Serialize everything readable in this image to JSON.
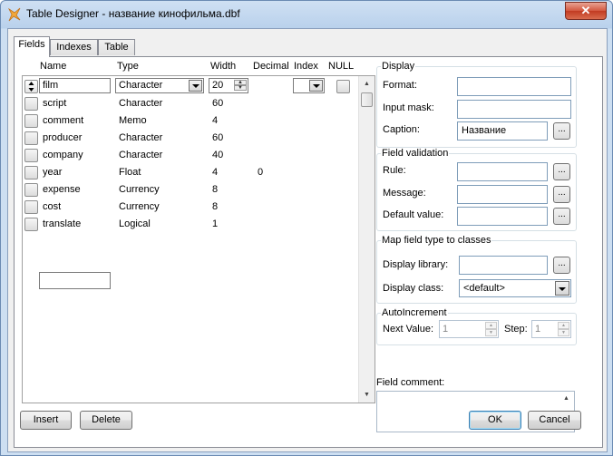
{
  "window": {
    "title": "Table Designer - название кинофильма.dbf",
    "close_glyph": "✕"
  },
  "tabs": [
    {
      "label": "Fields"
    },
    {
      "label": "Indexes"
    },
    {
      "label": "Table"
    }
  ],
  "grid": {
    "headers": {
      "name": "Name",
      "type": "Type",
      "width": "Width",
      "decimal": "Decimal",
      "index": "Index",
      "null": "NULL"
    },
    "editing": {
      "name": "film",
      "type": "Character",
      "width": "20"
    },
    "rows": [
      {
        "name": "script",
        "type": "Character",
        "width": "60",
        "decimal": ""
      },
      {
        "name": "comment",
        "type": "Memo",
        "width": "4",
        "decimal": ""
      },
      {
        "name": "producer",
        "type": "Character",
        "width": "60",
        "decimal": ""
      },
      {
        "name": "company",
        "type": "Character",
        "width": "40",
        "decimal": ""
      },
      {
        "name": "year",
        "type": "Float",
        "width": "4",
        "decimal": "0"
      },
      {
        "name": "expense",
        "type": "Currency",
        "width": "8",
        "decimal": ""
      },
      {
        "name": "cost",
        "type": "Currency",
        "width": "8",
        "decimal": ""
      },
      {
        "name": "translate",
        "type": "Logical",
        "width": "1",
        "decimal": ""
      }
    ]
  },
  "display": {
    "title": "Display",
    "format_label": "Format:",
    "format_value": "",
    "input_mask_label": "Input mask:",
    "input_mask_value": "",
    "caption_label": "Caption:",
    "caption_value": "Название"
  },
  "validation": {
    "title": "Field validation",
    "rule_label": "Rule:",
    "message_label": "Message:",
    "default_label": "Default value:"
  },
  "mapping": {
    "title": "Map field type to classes",
    "library_label": "Display library:",
    "library_value": "",
    "class_label": "Display class:",
    "class_value": "<default>"
  },
  "autoincrement": {
    "title": "AutoIncrement",
    "next_label": "Next Value:",
    "next_value": "1",
    "step_label": "Step:",
    "step_value": "1"
  },
  "comment": {
    "label": "Field comment:",
    "value": ""
  },
  "buttons": {
    "insert": "Insert",
    "delete": "Delete",
    "ok": "OK",
    "cancel": "Cancel",
    "ellipsis": "..."
  }
}
